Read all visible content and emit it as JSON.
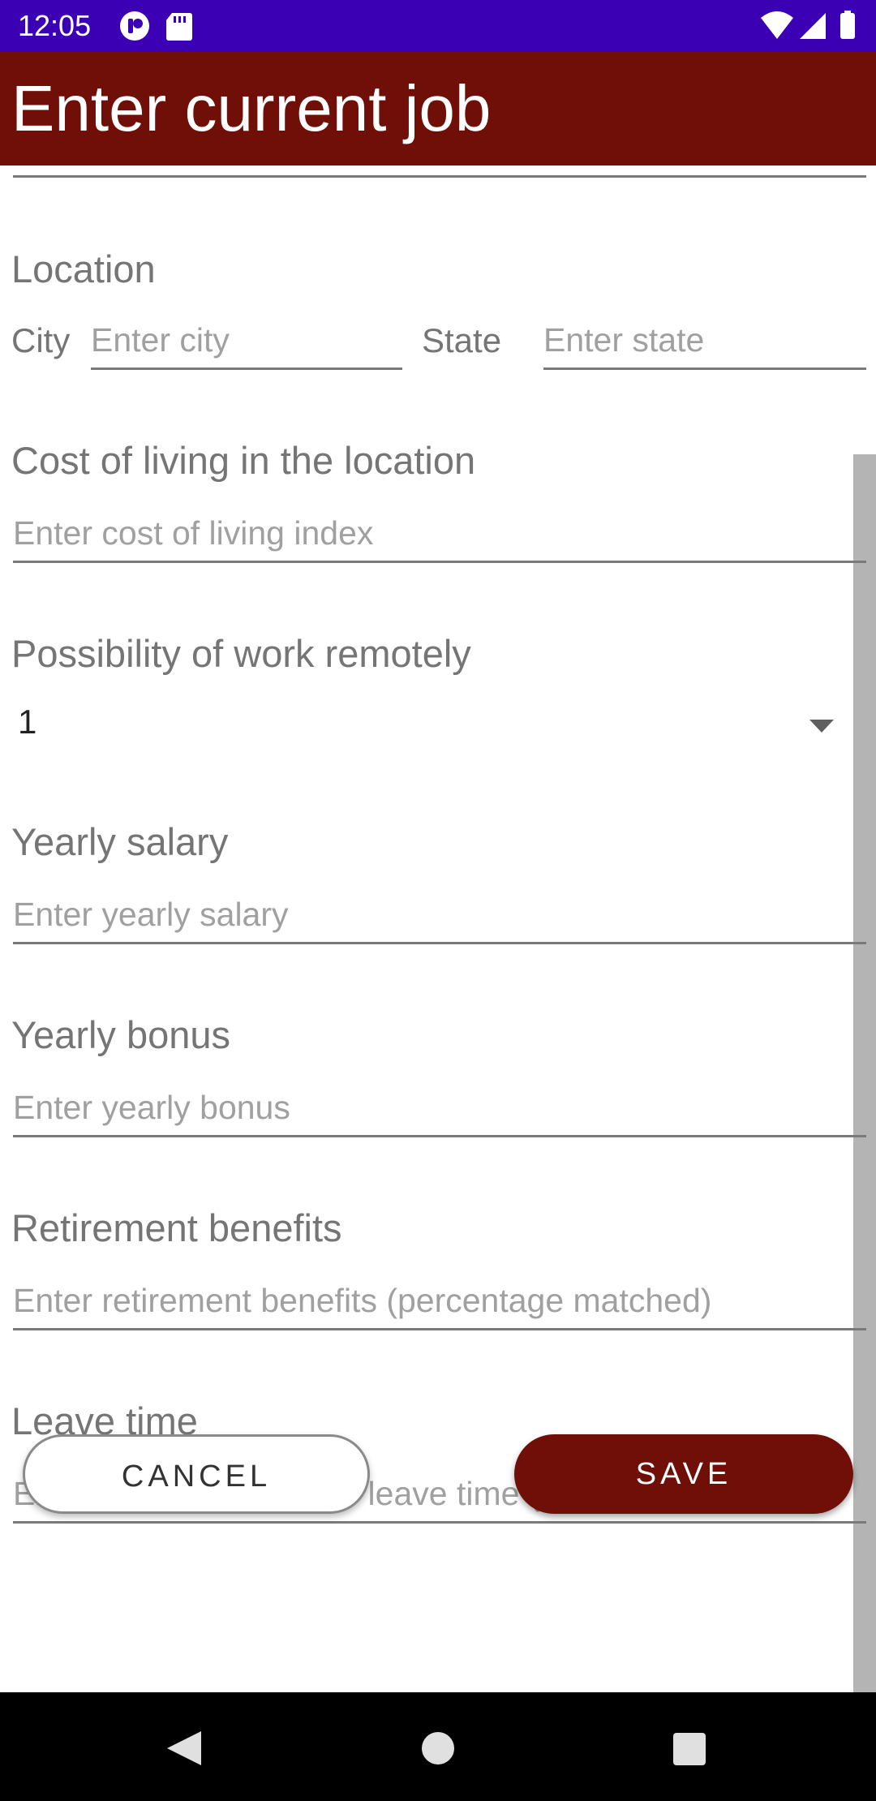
{
  "status_bar": {
    "time": "12:05",
    "left_icons": [
      "app-notification-icon",
      "sd-card-icon"
    ],
    "right_icons": [
      "wifi-icon",
      "signal-icon",
      "battery-icon"
    ],
    "background": "#3c00b4"
  },
  "app_bar": {
    "title": "Enter current job",
    "background": "#6f0f07"
  },
  "form": {
    "location": {
      "label": "Location",
      "city_label": "City",
      "city_placeholder": "Enter city",
      "state_label": "State",
      "state_placeholder": "Enter state"
    },
    "cost_of_living": {
      "label": "Cost of living in the location",
      "placeholder": "Enter cost of living index"
    },
    "remote": {
      "label": "Possibility of work remotely",
      "selected_value": "1"
    },
    "salary": {
      "label": "Yearly salary",
      "placeholder": "Enter yearly salary"
    },
    "bonus": {
      "label": "Yearly bonus",
      "placeholder": "Enter yearly bonus"
    },
    "retirement": {
      "label": "Retirement benefits",
      "placeholder": "Enter retirement benefits (percentage matched)"
    },
    "leave": {
      "label": "Leave time",
      "placeholder": "Enter overall number of leave time (days)"
    }
  },
  "buttons": {
    "cancel_label": "CANCEL",
    "save_label": "SAVE",
    "save_color": "#6f0f07"
  },
  "nav_bar": {
    "icons": [
      "back-icon",
      "home-icon",
      "recents-icon"
    ]
  }
}
